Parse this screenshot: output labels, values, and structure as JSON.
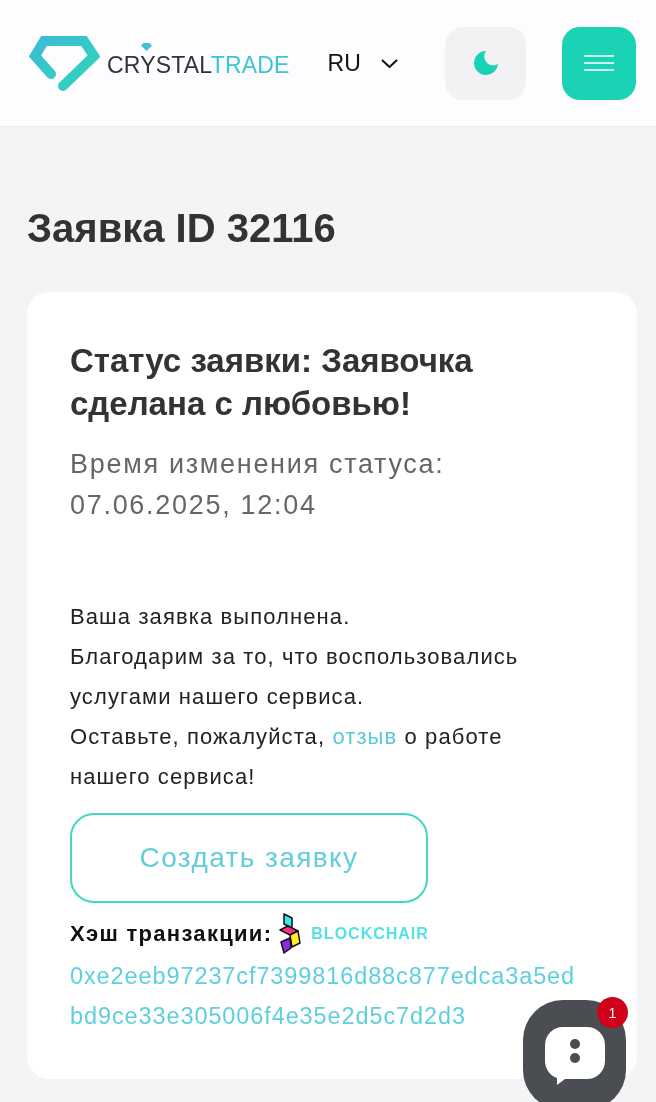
{
  "header": {
    "logo": {
      "text": "CRYSTAL",
      "accent": "TRADE"
    },
    "language": "RU"
  },
  "page_title": "Заявка ID 32116",
  "order_card": {
    "status_title": "Статус заявки: Заявочка сделана с любовью!",
    "status_changed_label": "Время изменения статуса:",
    "status_changed_time": "07.06.2025, 12:04",
    "message_lines": [
      "Ваша заявка выполнена.",
      "Благодарим за то, что воспользовались услугами нашего сервиса."
    ],
    "review_request": {
      "before": "Оставьте, пожалуйста,",
      "link": "отзыв",
      "after": "о работе нашего сервиса!"
    },
    "create_button": "Создать заявку",
    "hash_label": "Хэш транзакции:",
    "explorer_link": "BLOCKCHAIR",
    "transaction_hash": "0xe2eeb97237cf7399816d88c877edca3a5edbd9ce33e305006f4e35e2d5c7d2d3"
  },
  "chat_widget": {
    "unread_count": "1"
  }
}
